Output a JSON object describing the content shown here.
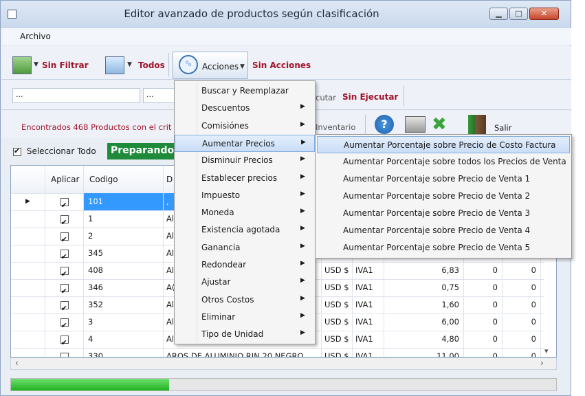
{
  "window": {
    "title": "Editor avanzado de productos según clasificación"
  },
  "menubar": {
    "archivo": "Archivo"
  },
  "toolbar1": {
    "sin_filtrar": "Sin Filtrar",
    "todos": "Todos",
    "acciones": "Acciones",
    "sin_acciones": "Sin Acciones"
  },
  "toolbar2": {
    "field1_value": "...",
    "field2_value": "...",
    "ejecutar_partial": "cutar",
    "sin_ejecutar": "Sin Ejecutar"
  },
  "toolbar3": {
    "found_text": "Encontrados 468 Productos con el crit",
    "inventario_partial": "Inventario",
    "salir": "Salir",
    "help_glyph": "?"
  },
  "select_all": {
    "label": "Seleccionar Todo",
    "status": "Preparando"
  },
  "grid": {
    "headers": {
      "aplicar": "Aplicar",
      "codigo": "Codigo",
      "desc": "D"
    },
    "rows": [
      {
        "code": "101",
        "desc": ",",
        "cur": "",
        "tax": "",
        "price": "",
        "a": "",
        "b": ""
      },
      {
        "code": "1",
        "desc": "Al",
        "cur": "",
        "tax": "",
        "price": "",
        "a": "",
        "b": ""
      },
      {
        "code": "2",
        "desc": "Al",
        "cur": "",
        "tax": "",
        "price": "",
        "a": "",
        "b": ""
      },
      {
        "code": "345",
        "desc": "Al",
        "cur": "",
        "tax": "",
        "price": "",
        "a": "",
        "b": ""
      },
      {
        "code": "408",
        "desc": "Al",
        "cur": "USD $",
        "tax": "IVA1",
        "price": "6,83",
        "a": "0",
        "b": "0"
      },
      {
        "code": "346",
        "desc": "A(",
        "cur": "USD $",
        "tax": "IVA1",
        "price": "0,75",
        "a": "0",
        "b": "0"
      },
      {
        "code": "352",
        "desc": "Al",
        "cur": "USD $",
        "tax": "IVA1",
        "price": "1,60",
        "a": "0",
        "b": "0"
      },
      {
        "code": "3",
        "desc": "Al",
        "cur": "USD $",
        "tax": "IVA1",
        "price": "6,00",
        "a": "0",
        "b": "0"
      },
      {
        "code": "4",
        "desc": "Al",
        "cur": "USD $",
        "tax": "IVA1",
        "price": "4,80",
        "a": "0",
        "b": "0"
      },
      {
        "code": "330",
        "desc": "AROS DE ALUMINIO RIN 20 NEGRO",
        "cur": "USD $",
        "tax": "IVA1",
        "price": "11,00",
        "a": "0",
        "b": "0"
      }
    ]
  },
  "acciones_menu": [
    {
      "label": "Buscar y Reemplazar",
      "arrow": ""
    },
    {
      "label": "Descuentos",
      "arrow": "▶"
    },
    {
      "label": "Comisiónes",
      "arrow": "▶"
    },
    {
      "label": "Aumentar Precios",
      "arrow": "▶"
    },
    {
      "label": "Disminuir Precios",
      "arrow": "▶"
    },
    {
      "label": "Establecer precios",
      "arrow": "▶"
    },
    {
      "label": "Impuesto",
      "arrow": "▶"
    },
    {
      "label": "Moneda",
      "arrow": "▶"
    },
    {
      "label": "Existencia agotada",
      "arrow": "▶"
    },
    {
      "label": "Ganancia",
      "arrow": "▶"
    },
    {
      "label": "Redondear",
      "arrow": "▶"
    },
    {
      "label": "Ajustar",
      "arrow": "▶"
    },
    {
      "label": "Otros Costos",
      "arrow": "▶"
    },
    {
      "label": "Eliminar",
      "arrow": "▶"
    },
    {
      "label": "Tipo de Unidad",
      "arrow": "▶"
    }
  ],
  "aumentar_submenu": [
    "Aumentar Porcentaje sobre Precio de Costo Factura",
    "Aumentar Porcentaje sobre todos los Precios de Venta",
    "Aumentar Porcentaje sobre Precio de Venta 1",
    "Aumentar Porcentaje sobre Precio de Venta 2",
    "Aumentar Porcentaje sobre Precio de Venta 3",
    "Aumentar Porcentaje sobre Precio de Venta 4",
    "Aumentar Porcentaje sobre Precio de Venta 5"
  ],
  "progress": {
    "fraction": 0.29
  }
}
